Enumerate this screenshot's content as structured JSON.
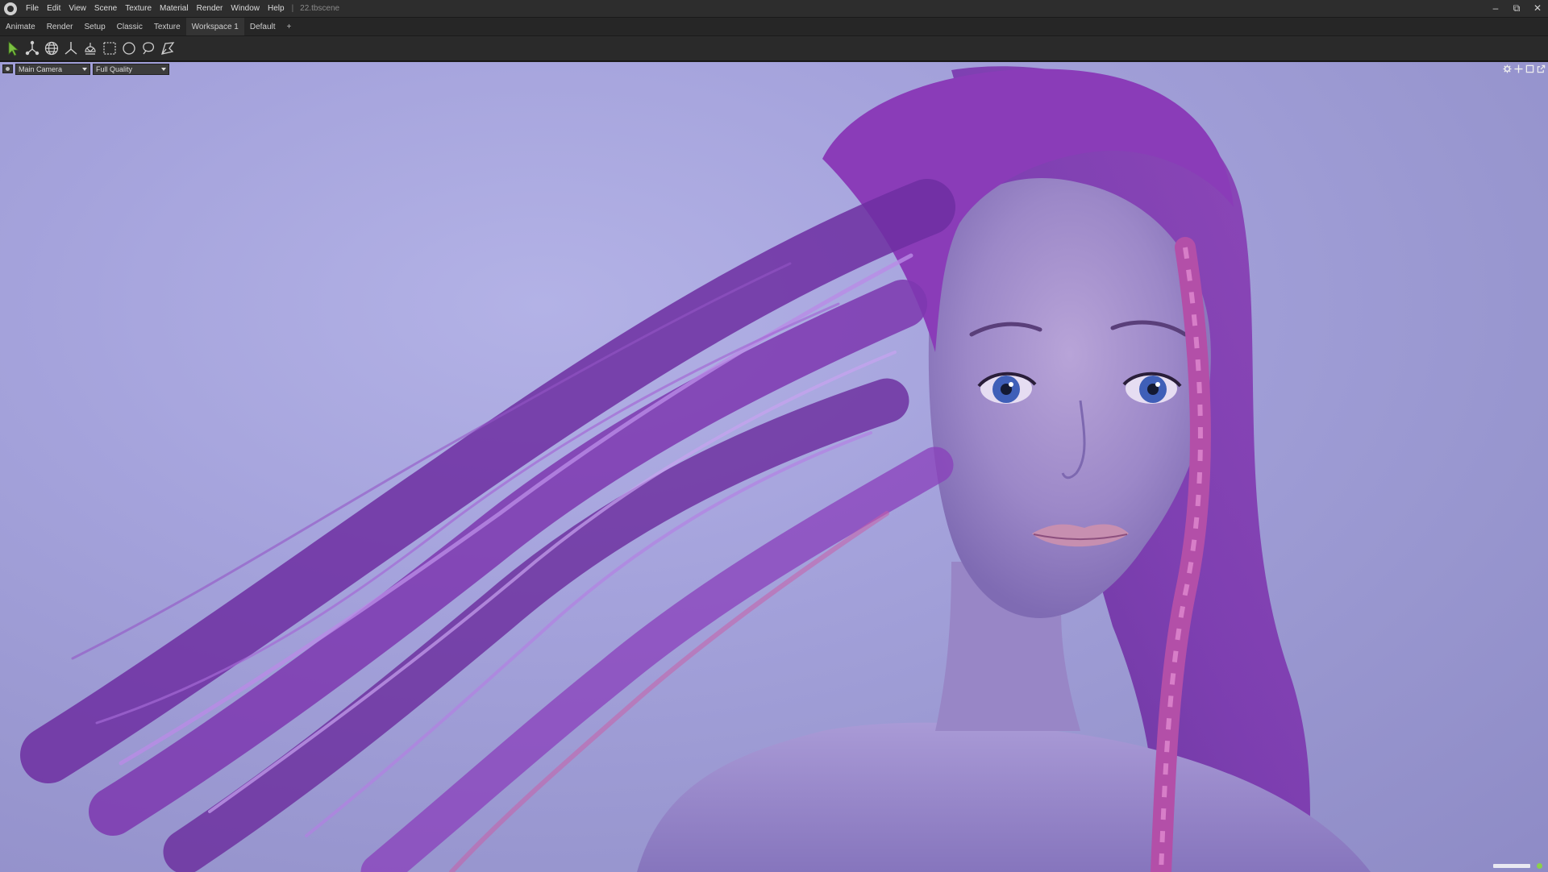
{
  "menu": {
    "items": [
      "File",
      "Edit",
      "View",
      "Scene",
      "Texture",
      "Material",
      "Render",
      "Window",
      "Help"
    ],
    "separator": "|",
    "scene_file": "22.tbscene"
  },
  "window_controls": {
    "minimize": "–",
    "maximize": "⧉",
    "close": "✕"
  },
  "workspace_tabs": [
    "Animate",
    "Render",
    "Setup",
    "Classic",
    "Texture",
    "Workspace 1",
    "Default",
    "+"
  ],
  "active_tab": "Workspace 1",
  "toolbar": {
    "tools": [
      "select-arrow-icon",
      "move-gizmo-icon",
      "sphere-grid-icon",
      "axis-gizmo-icon",
      "lamp-icon",
      "marquee-select-icon",
      "circle-select-icon",
      "lasso-select-icon",
      "pen-select-icon"
    ],
    "accent_color": "#7bc142"
  },
  "viewport": {
    "camera": "Main Camera",
    "quality": "Full Quality",
    "header_icons": [
      "settings-icon",
      "move-view-icon",
      "maximize-view-icon",
      "popout-icon"
    ],
    "background_color": "#a5a3dc",
    "status_indicator_color": "#8bd14a"
  }
}
